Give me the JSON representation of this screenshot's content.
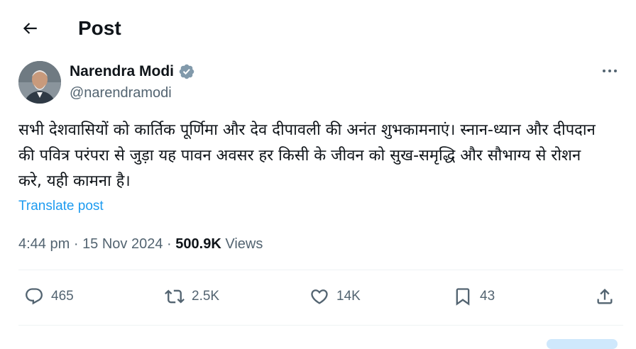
{
  "header": {
    "title": "Post",
    "back_icon": "arrow-left-icon"
  },
  "author": {
    "name": "Narendra Modi",
    "handle": "@narendramodi",
    "verified_icon": "verified-badge-icon",
    "verified_color": "#1d9bf0"
  },
  "post": {
    "text": "सभी देशवासियों को कार्तिक पूर्णिमा और देव दीपावली की अनंत शुभकामनाएं। स्नान-ध्यान और दीपदान की पवित्र परंपरा से जुड़ा यह पावन अवसर हर किसी के जीवन को सुख-समृद्धि और सौभाग्य से रोशन करे, यही कामना है।",
    "translate_label": "Translate post",
    "time": "4:44 pm",
    "date": "15 Nov 2024",
    "separator": "·",
    "views_count": "500.9K",
    "views_label": "Views"
  },
  "actions": {
    "reply": {
      "icon": "reply-icon",
      "count": "465"
    },
    "repost": {
      "icon": "repost-icon",
      "count": "2.5K"
    },
    "like": {
      "icon": "heart-icon",
      "count": "14K"
    },
    "bookmark": {
      "icon": "bookmark-icon",
      "count": "43"
    },
    "share": {
      "icon": "share-icon"
    }
  },
  "colors": {
    "accent": "#1d9bf0",
    "secondary_text": "#536471",
    "primary_text": "#0f1419"
  }
}
